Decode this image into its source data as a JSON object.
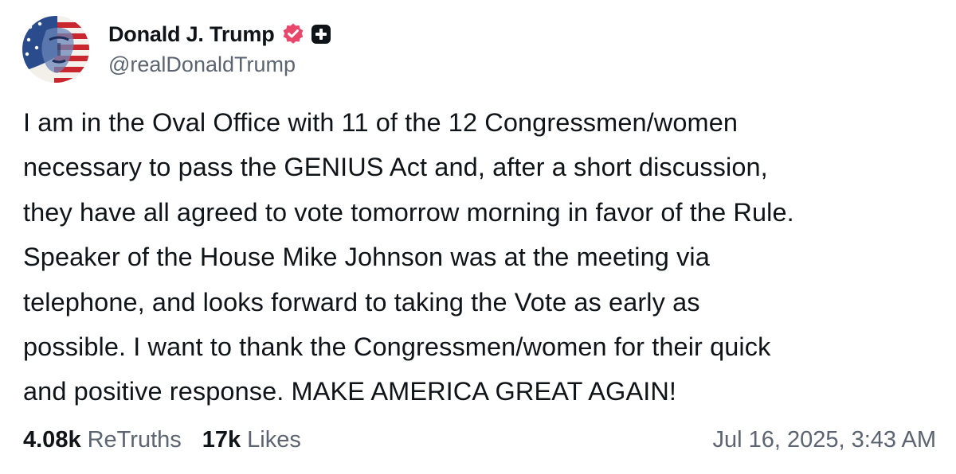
{
  "author": {
    "display_name": "Donald J. Trump",
    "handle": "@realDonaldTrump",
    "verified_icon": "verified-badge-icon",
    "plus_icon": "plus-badge-icon"
  },
  "post": {
    "text": "I am in the Oval Office with 11 of the 12 Congressmen/women\nnecessary to pass the GENIUS Act and, after a short discussion,\nthey have all agreed to vote tomorrow morning in favor of the Rule.\nSpeaker of the House Mike Johnson was at the meeting via\ntelephone, and looks forward to taking the Vote as early as\npossible. I want to thank the Congressmen/women for their quick\nand positive response. MAKE AMERICA GREAT AGAIN!"
  },
  "stats": {
    "retruths_count": "4.08k",
    "retruths_label": "ReTruths",
    "likes_count": "17k",
    "likes_label": "Likes"
  },
  "timestamp": "Jul 16, 2025, 3:43 AM",
  "colors": {
    "verified": "#e8476b",
    "plus_badge": "#0f1419",
    "muted_text": "#5b6470",
    "text": "#0f1419"
  }
}
